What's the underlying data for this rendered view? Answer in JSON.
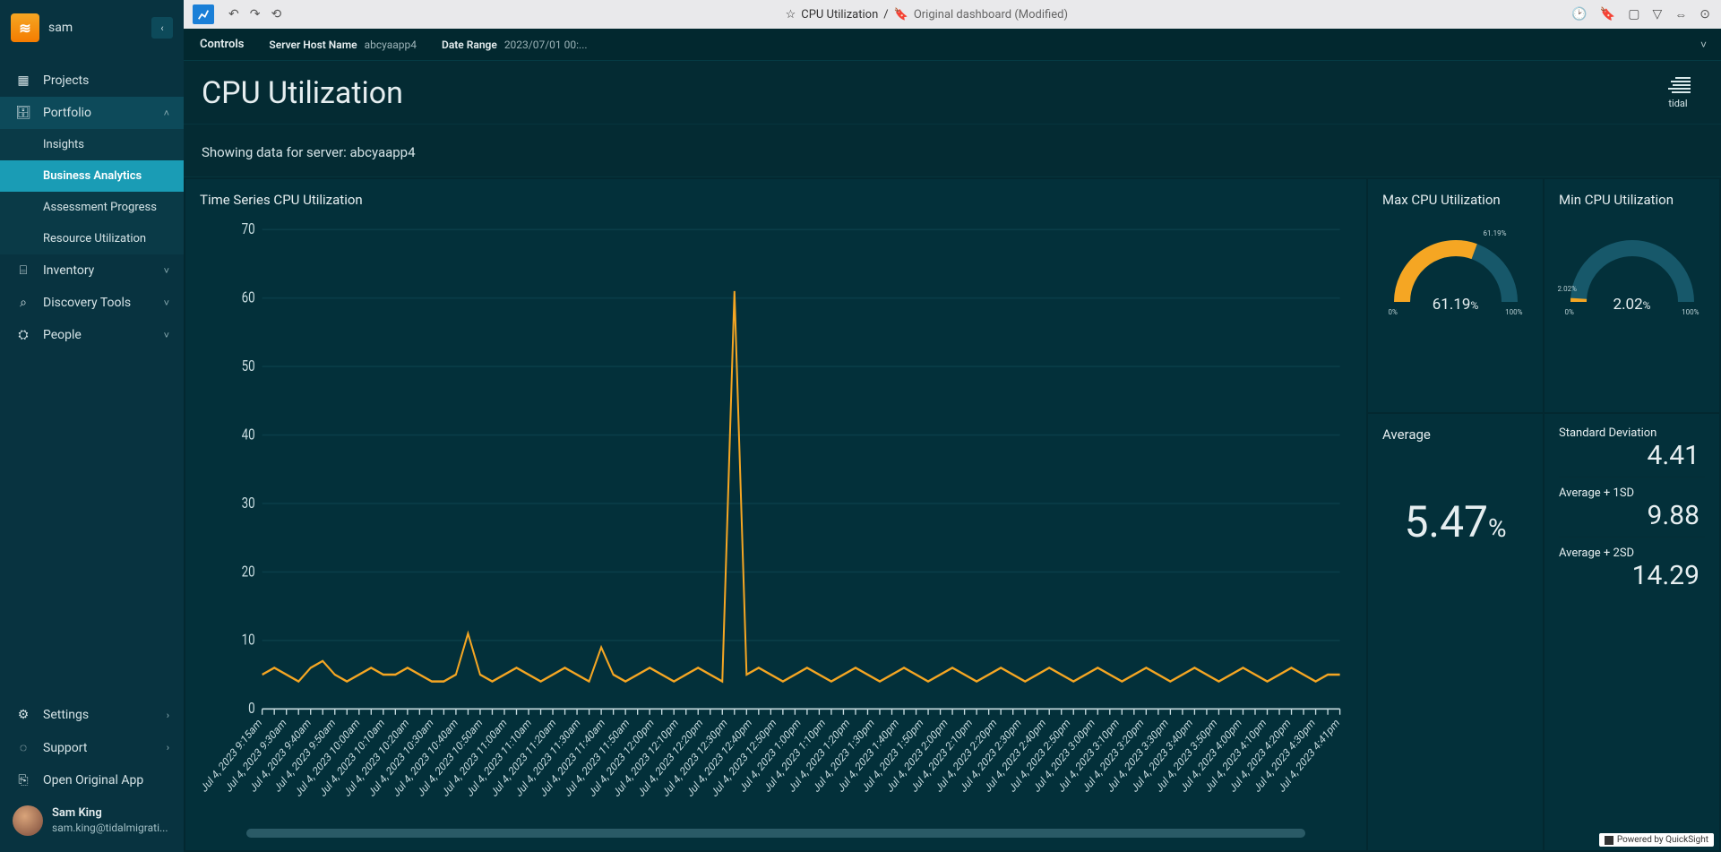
{
  "sidebar": {
    "user_name": "sam",
    "items": [
      {
        "icon": "📦",
        "label": "Projects"
      },
      {
        "icon": "💼",
        "label": "Portfolio",
        "expanded": true
      },
      {
        "icon": "🗂",
        "label": "Inventory",
        "chev": true
      },
      {
        "icon": "🔍",
        "label": "Discovery Tools",
        "chev": true
      },
      {
        "icon": "👥",
        "label": "People",
        "chev": true
      }
    ],
    "portfolio_sub": [
      {
        "label": "Insights"
      },
      {
        "label": "Business Analytics",
        "active": true
      },
      {
        "label": "Assessment Progress"
      },
      {
        "label": "Resource Utilization"
      }
    ],
    "footer": [
      {
        "icon": "⚙",
        "label": "Settings",
        "chev": true
      },
      {
        "icon": "?",
        "label": "Support",
        "chev": true
      },
      {
        "icon": "↗",
        "label": "Open Original App"
      }
    ],
    "user_card": {
      "name": "Sam King",
      "email": "sam.king@tidalmigrati..."
    }
  },
  "topbar": {
    "breadcrumb_main": "CPU Utilization",
    "breadcrumb_sep": "/",
    "dashboard_label": "Original dashboard (Modified)"
  },
  "controls": {
    "label": "Controls",
    "server_k": "Server Host Name",
    "server_v": "abcyaapp4",
    "date_k": "Date Range",
    "date_v": "2023/07/01 00:..."
  },
  "page": {
    "title": "CPU Utilization",
    "brand": "tidal",
    "subhead": "Showing data for server: abcyaapp4"
  },
  "panels": {
    "ts_title": "Time Series CPU Utilization",
    "max_title": "Max CPU Utilization",
    "min_title": "Min CPU Utilization",
    "avg_title": "Average",
    "sd_title": "Standard Deviation",
    "a1sd_title": "Average + 1SD",
    "a2sd_title": "Average + 2SD"
  },
  "stats": {
    "max": "61.19",
    "max_pct": "%",
    "max_cur": "61.19%",
    "min": "2.02",
    "min_pct": "%",
    "min_cur": "2.02%",
    "avg": "5.47",
    "avg_pct": "%",
    "sd": "4.41",
    "a1sd": "9.88",
    "a2sd": "14.29",
    "zero": "0%",
    "hundred": "100%"
  },
  "footer": {
    "text": "Powered by QuickSight"
  },
  "chart_data": {
    "type": "line",
    "title": "Time Series CPU Utilization",
    "xlabel": "",
    "ylabel": "",
    "ylim": [
      0,
      70
    ],
    "yticks": [
      0,
      10,
      20,
      30,
      40,
      50,
      60,
      70
    ],
    "categories": [
      "Jul 4, 2023 9:15am",
      "Jul 4, 2023 9:30am",
      "Jul 4, 2023 9:40am",
      "Jul 4, 2023 9:50am",
      "Jul 4, 2023 10:00am",
      "Jul 4, 2023 10:10am",
      "Jul 4, 2023 10:20am",
      "Jul 4, 2023 10:30am",
      "Jul 4, 2023 10:40am",
      "Jul 4, 2023 10:50am",
      "Jul 4, 2023 11:00am",
      "Jul 4, 2023 11:10am",
      "Jul 4, 2023 11:20am",
      "Jul 4, 2023 11:30am",
      "Jul 4, 2023 11:40am",
      "Jul 4, 2023 11:50am",
      "Jul 4, 2023 12:00pm",
      "Jul 4, 2023 12:10pm",
      "Jul 4, 2023 12:20pm",
      "Jul 4, 2023 12:30pm",
      "Jul 4, 2023 12:40pm",
      "Jul 4, 2023 12:50pm",
      "Jul 4, 2023 1:00pm",
      "Jul 4, 2023 1:10pm",
      "Jul 4, 2023 1:20pm",
      "Jul 4, 2023 1:30pm",
      "Jul 4, 2023 1:40pm",
      "Jul 4, 2023 1:50pm",
      "Jul 4, 2023 2:00pm",
      "Jul 4, 2023 2:10pm",
      "Jul 4, 2023 2:20pm",
      "Jul 4, 2023 2:30pm",
      "Jul 4, 2023 2:40pm",
      "Jul 4, 2023 2:50pm",
      "Jul 4, 2023 3:00pm",
      "Jul 4, 2023 3:10pm",
      "Jul 4, 2023 3:20pm",
      "Jul 4, 2023 3:30pm",
      "Jul 4, 2023 3:40pm",
      "Jul 4, 2023 3:50pm",
      "Jul 4, 2023 4:00pm",
      "Jul 4, 2023 4:10pm",
      "Jul 4, 2023 4:20pm",
      "Jul 4, 2023 4:30pm",
      "Jul 4, 2023 4:41pm"
    ],
    "values": [
      5,
      6,
      5,
      4,
      6,
      7,
      5,
      4,
      5,
      6,
      5,
      5,
      6,
      5,
      4,
      4,
      5,
      11,
      5,
      4,
      5,
      6,
      5,
      4,
      5,
      6,
      5,
      4,
      9,
      5,
      4,
      5,
      6,
      5,
      4,
      5,
      6,
      5,
      4,
      61,
      5,
      6,
      5,
      4,
      5,
      6,
      5,
      4,
      5,
      6,
      5,
      4,
      5,
      6,
      5,
      4,
      5,
      6,
      5,
      4,
      5,
      6,
      5,
      4,
      5,
      6,
      5,
      4,
      5,
      6,
      5,
      4,
      5,
      6,
      5,
      4,
      5,
      6,
      5,
      4,
      5,
      6,
      5,
      4,
      5,
      6,
      5,
      4,
      5,
      5
    ]
  }
}
